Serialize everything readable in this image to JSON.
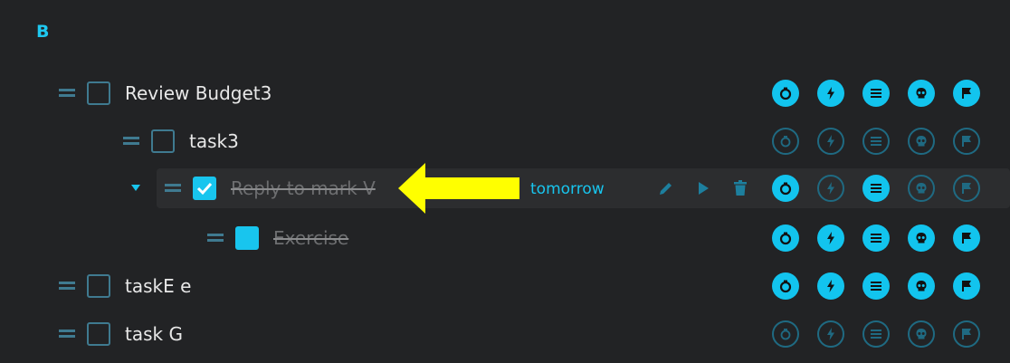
{
  "section": {
    "title": "B"
  },
  "tasks": [
    {
      "title": "Review Budget3",
      "checked": false,
      "completed": false,
      "icons_active": true
    },
    {
      "title": "task3",
      "checked": false,
      "completed": false,
      "icons_active": false
    },
    {
      "title": "Reply to mark V",
      "checked": true,
      "completed": true,
      "due": "tomorrow",
      "icons_active": false,
      "selected_row": true
    },
    {
      "title": "Exercise",
      "checked": true,
      "completed": true,
      "icons_active": true
    },
    {
      "title": "taskE e",
      "checked": false,
      "completed": false,
      "icons_active": true
    },
    {
      "title": "task G",
      "checked": false,
      "completed": false,
      "icons_active": false
    }
  ],
  "row_icons": [
    "timer-icon",
    "lightning-icon",
    "list-icon",
    "skull-icon",
    "flag-icon"
  ],
  "row_actions": [
    "edit-icon",
    "play-icon",
    "delete-icon"
  ],
  "colors": {
    "accent": "#18c5ee",
    "background": "#222325",
    "muted": "#3f7a90",
    "annotation_arrow": "#ffff00"
  }
}
